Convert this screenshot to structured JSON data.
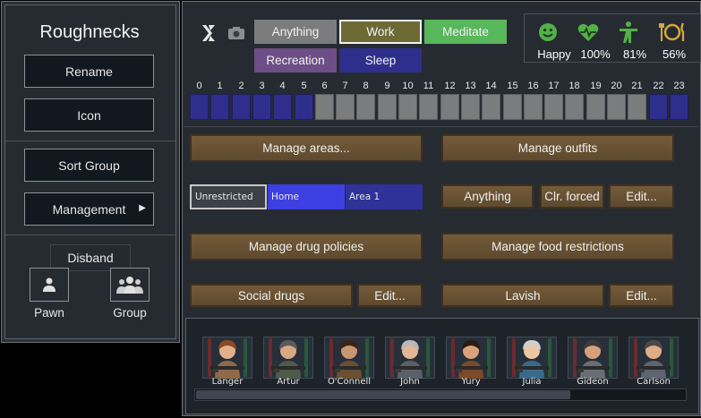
{
  "left_panel": {
    "title": "Roughnecks",
    "rename": "Rename",
    "icon": "Icon",
    "sort_group": "Sort Group",
    "management": "Management",
    "disband": "Disband",
    "pawn": "Pawn",
    "group": "Group"
  },
  "schedule": {
    "tabs": {
      "anything": "Anything",
      "work": "Work",
      "meditate": "Meditate",
      "recreation": "Recreation",
      "sleep": "Sleep"
    },
    "hours": [
      "0",
      "1",
      "2",
      "3",
      "4",
      "5",
      "6",
      "7",
      "8",
      "9",
      "10",
      "11",
      "12",
      "13",
      "14",
      "15",
      "16",
      "17",
      "18",
      "19",
      "20",
      "21",
      "22",
      "23"
    ],
    "hour_assignments": [
      "sleep",
      "sleep",
      "sleep",
      "sleep",
      "sleep",
      "sleep",
      "anything",
      "anything",
      "anything",
      "anything",
      "anything",
      "anything",
      "anything",
      "anything",
      "anything",
      "anything",
      "anything",
      "anything",
      "anything",
      "anything",
      "anything",
      "anything",
      "sleep",
      "sleep"
    ],
    "colors": {
      "sleep": "#2e2f8c",
      "anything": "#7b7c7e",
      "work": "#6e6a36",
      "meditate": "#58b65b",
      "recreation": "#6d4e86"
    }
  },
  "needs": {
    "mood": "Happy",
    "health": "100%",
    "rest": "81%",
    "food": "56%"
  },
  "management": {
    "manage_areas": "Manage areas...",
    "manage_outfits": "Manage outfits",
    "area_unrestricted": "Unrestricted",
    "area_home": "Home",
    "area_1": "Area 1",
    "outfit_anything": "Anything",
    "clr_forced": "Clr. forced",
    "edit": "Edit...",
    "manage_drug": "Manage drug policies",
    "manage_food": "Manage food restrictions",
    "social_drugs": "Social drugs",
    "lavish": "Lavish"
  },
  "pawns": [
    {
      "name": "Langer"
    },
    {
      "name": "Artur"
    },
    {
      "name": "O'Connell"
    },
    {
      "name": "John"
    },
    {
      "name": "Yury"
    },
    {
      "name": "Julia"
    },
    {
      "name": "Gideon"
    },
    {
      "name": "Carlson"
    }
  ]
}
